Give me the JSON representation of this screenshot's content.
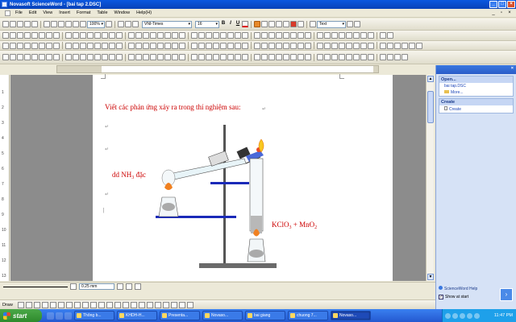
{
  "window": {
    "title": "Novasoft ScienceWord - [bai tap 2.DSC]"
  },
  "menu": [
    "File",
    "Edit",
    "View",
    "Insert",
    "Format",
    "Table",
    "Window",
    "Help(H)"
  ],
  "toolbar": {
    "zoom": "100%",
    "font": "VNI-Times",
    "size": "16",
    "bold": "B",
    "italic": "I",
    "underline": "U",
    "text_combo": "Text"
  },
  "document": {
    "instruction": "Viết các phản ứng xảy ra trong thí nghiệm sau:",
    "label_nh3": "dd NH",
    "label_nh3_sub": "3",
    "label_nh3_tail": " đặc",
    "label_kclo3": "KClO",
    "label_kclo3_sub": "3",
    "label_mno2": " + MnO",
    "label_mno2_sub": "2",
    "para_mark": "↵"
  },
  "statusbar": {
    "line_width": "0.25 mm"
  },
  "drawbar": {
    "label": "Draw"
  },
  "taskpane": {
    "title": "",
    "open_header": "Open...",
    "recent_file": "bai tap.DSC",
    "more": "More...",
    "create_header": "Create",
    "create_item": "Create",
    "help": "ScienceWord Help",
    "show_at_start": "Show at start"
  },
  "taskbar": {
    "start": "start",
    "tasks": [
      "Thông b...",
      "KHDH-H...",
      "Presenta...",
      "Novaso...",
      "bai giang",
      "chuong 7...",
      "Novaso..."
    ],
    "clock": "11:47 PM"
  },
  "colors": {
    "title_blue": "#0a58e0",
    "doc_red": "#cc0000",
    "stand_blue": "#1a2ab8",
    "taskbar": "#2458d0"
  }
}
